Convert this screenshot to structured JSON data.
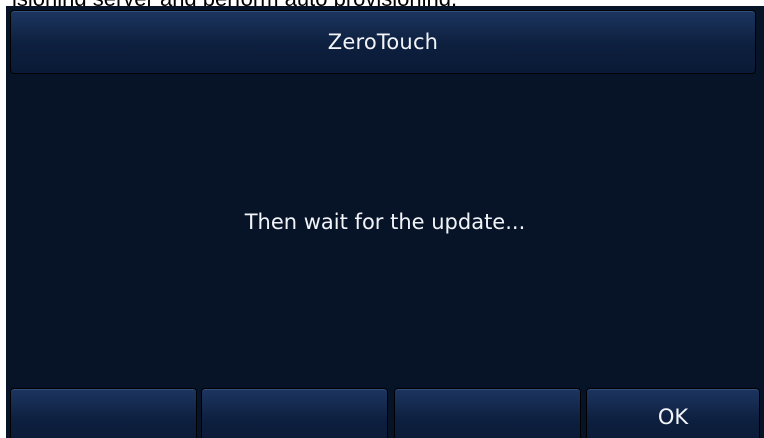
{
  "document": {
    "cropped_text": "isioning server and perform auto provisioning."
  },
  "dialog": {
    "title": "ZeroTouch",
    "message": "Then wait for the update..."
  },
  "softkeys": [
    {
      "label": ""
    },
    {
      "label": ""
    },
    {
      "label": ""
    },
    {
      "label": "OK"
    }
  ],
  "colors": {
    "screen_background": "#071428",
    "bar_gradient_top": "#1c3560",
    "bar_gradient_bottom": "#0a1a36",
    "text": "#f2f4f8"
  }
}
